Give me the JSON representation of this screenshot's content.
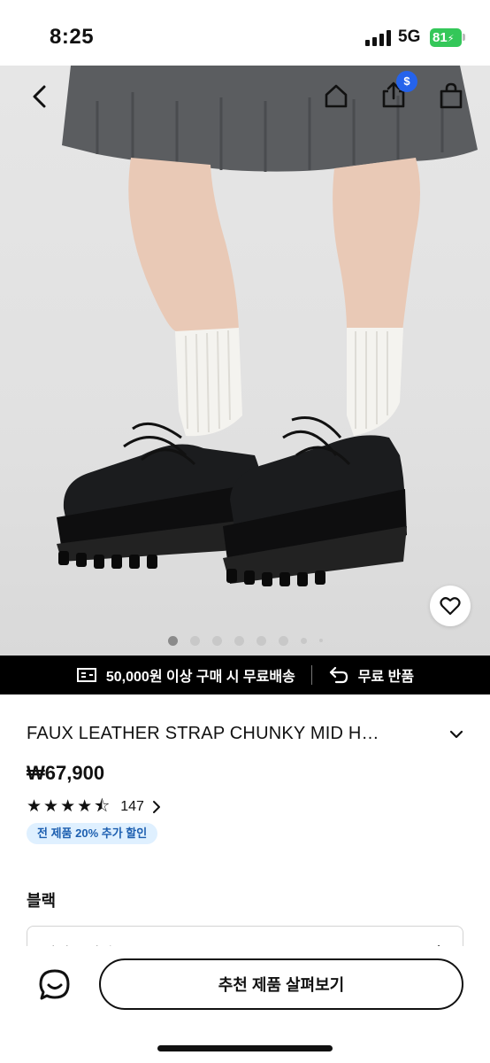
{
  "status_bar": {
    "time": "8:25",
    "network": "5G",
    "battery": "81"
  },
  "hero": {
    "share_badge": "$",
    "carousel_total": 8,
    "carousel_active": 1
  },
  "promo": {
    "shipping_text": "50,000원 이상 구매 시 무료배송",
    "returns_text": "무료 반품"
  },
  "product": {
    "title": "FAUX LEATHER STRAP CHUNKY MID H…",
    "price": "₩67,900",
    "rating_value": 4.5,
    "stars": [
      "★",
      "★",
      "★",
      "★",
      "⯪"
    ],
    "review_count": "147",
    "discount_badge": "전 제품 20% 추가 할인",
    "color_label": "블랙",
    "size_select_text": "사이즈 선택"
  },
  "bottom_bar": {
    "cta_label": "추천 제품 살펴보기"
  },
  "colors": {
    "accent_badge": "#2563eb",
    "battery": "#34c759",
    "promo_bg": "#000000",
    "discount_bg": "#dff0ff",
    "discount_text": "#1d5fb0"
  },
  "icons": [
    "back-arrow-icon",
    "home-icon",
    "share-icon",
    "shopping-bag-icon",
    "heart-icon",
    "truck-icon",
    "return-arrow-icon",
    "chevron-down-icon",
    "chevron-right-icon",
    "chat-icon"
  ]
}
